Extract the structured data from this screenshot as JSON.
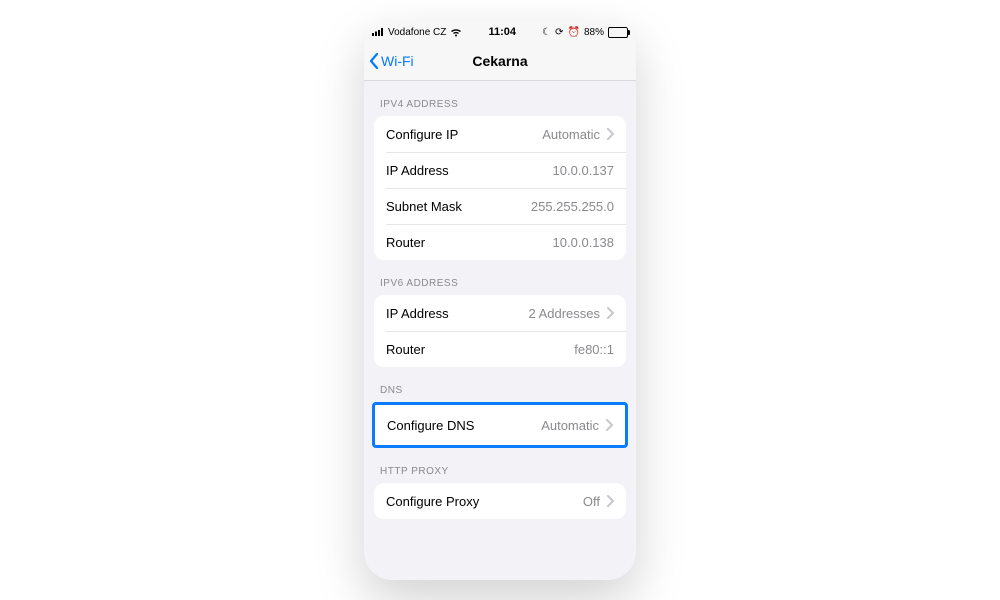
{
  "statusbar": {
    "carrier": "Vodafone CZ",
    "time": "11:04",
    "battery_pct": "88%"
  },
  "nav": {
    "back_label": "Wi-Fi",
    "title": "Cekarna"
  },
  "sections": {
    "ipv4": {
      "header": "IPV4 ADDRESS",
      "configure_label": "Configure IP",
      "configure_value": "Automatic",
      "ip_label": "IP Address",
      "ip_value": "10.0.0.137",
      "mask_label": "Subnet Mask",
      "mask_value": "255.255.255.0",
      "router_label": "Router",
      "router_value": "10.0.0.138"
    },
    "ipv6": {
      "header": "IPV6 ADDRESS",
      "ip_label": "IP Address",
      "ip_value": "2 Addresses",
      "router_label": "Router",
      "router_value": "fe80::1"
    },
    "dns": {
      "header": "DNS",
      "configure_label": "Configure DNS",
      "configure_value": "Automatic"
    },
    "proxy": {
      "header": "HTTP PROXY",
      "configure_label": "Configure Proxy",
      "configure_value": "Off"
    }
  },
  "colors": {
    "accent": "#007aff",
    "highlight": "#0a7bff"
  }
}
